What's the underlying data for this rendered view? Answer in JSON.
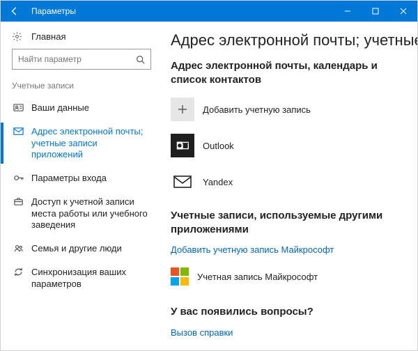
{
  "window": {
    "title": "Параметры"
  },
  "sidebar": {
    "home": "Главная",
    "search_placeholder": "Найти параметр",
    "section": "Учетные записи",
    "items": [
      {
        "label": "Ваши данные"
      },
      {
        "label": "Адрес электронной почты; учетные записи приложений"
      },
      {
        "label": "Параметры входа"
      },
      {
        "label": "Доступ к учетной записи места работы или учебного заведения"
      },
      {
        "label": "Семья и другие люди"
      },
      {
        "label": "Синхронизация ваших параметров"
      }
    ]
  },
  "main": {
    "heading": "Адрес электронной почты; учетные за",
    "section1": {
      "title": "Адрес электронной почты, календарь и список контактов",
      "add": "Добавить учетную запись",
      "accounts": [
        {
          "label": "Outlook"
        },
        {
          "label": "Yandex"
        }
      ]
    },
    "section2": {
      "title": "Учетные записи, используемые другими приложениями",
      "add_link": "Добавить учетную запись Майкрософт",
      "ms_account": "Учетная запись Майкрософт"
    },
    "help": {
      "title": "У вас появились вопросы?",
      "link": "Вызов справки"
    }
  }
}
